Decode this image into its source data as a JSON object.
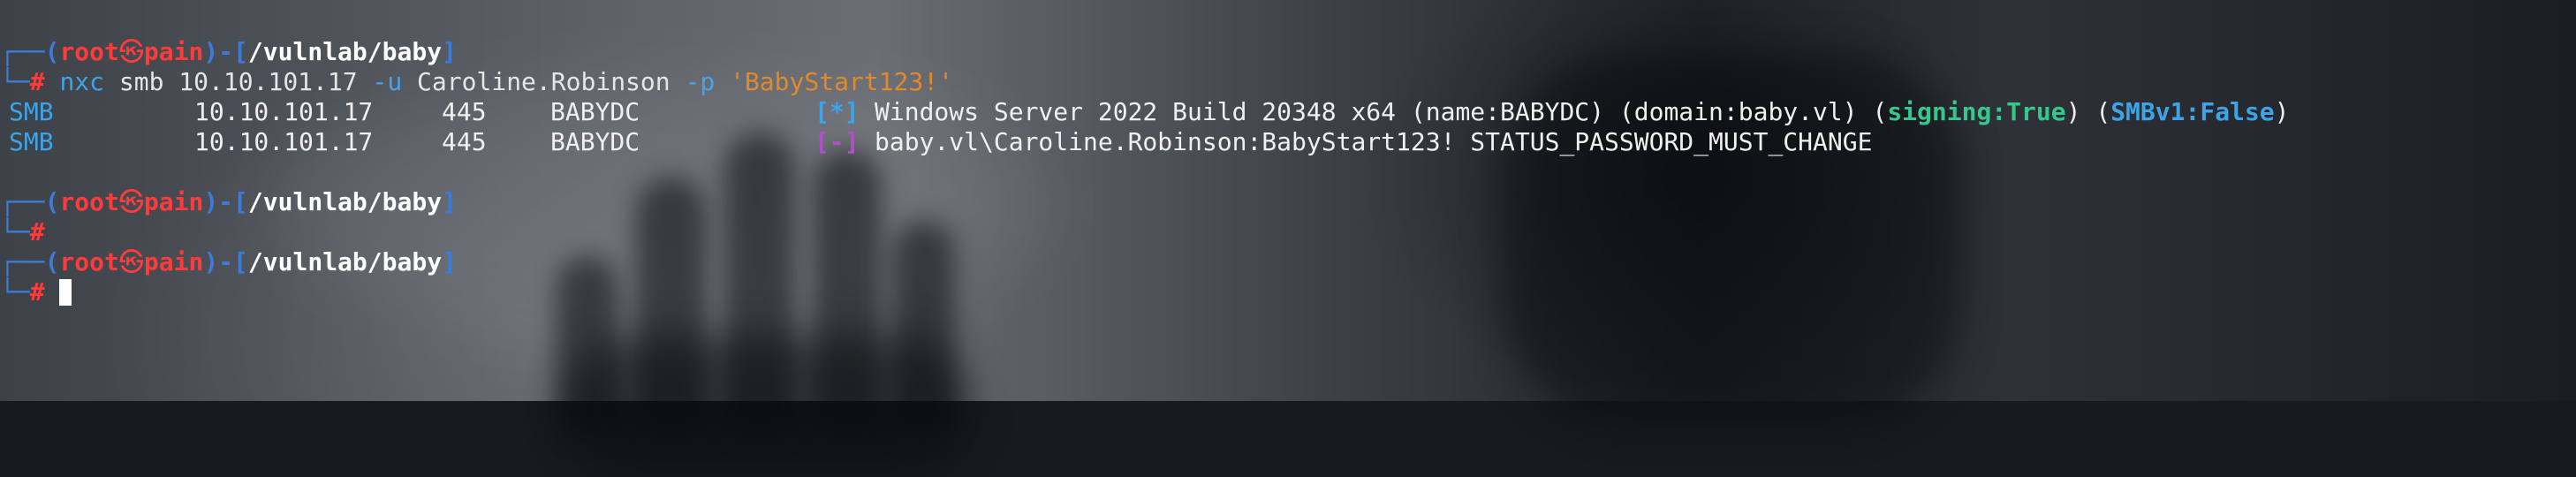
{
  "prompt": {
    "open": "┌──(",
    "user": "root",
    "skull": "㉿",
    "host": "pain",
    "mid": ")-[",
    "path": "/vulnlab/baby",
    "close": "]",
    "corner": "└─",
    "hash": "#"
  },
  "command": {
    "program": "nxc",
    "protocol": "smb",
    "target": "10.10.101.17",
    "user_flag": "-u",
    "user": "Caroline.Robinson",
    "pass_flag": "-p",
    "password": "'BabyStart123!'"
  },
  "output": [
    {
      "proto": "SMB",
      "ip": "10.10.101.17",
      "port": "445",
      "host": "BABYDC",
      "marker": "[*]",
      "text_before": "Windows Server 2022 Build 20348 x64 (name:BABYDC) (domain:baby.vl) (",
      "signing": "signing:True",
      "text_mid": ") (",
      "smbv1": "SMBv1:False",
      "text_after": ")"
    },
    {
      "proto": "SMB",
      "ip": "10.10.101.17",
      "port": "445",
      "host": "BABYDC",
      "marker": "[-]",
      "text": "baby.vl\\Caroline.Robinson:BabyStart123! STATUS_PASSWORD_MUST_CHANGE"
    }
  ]
}
